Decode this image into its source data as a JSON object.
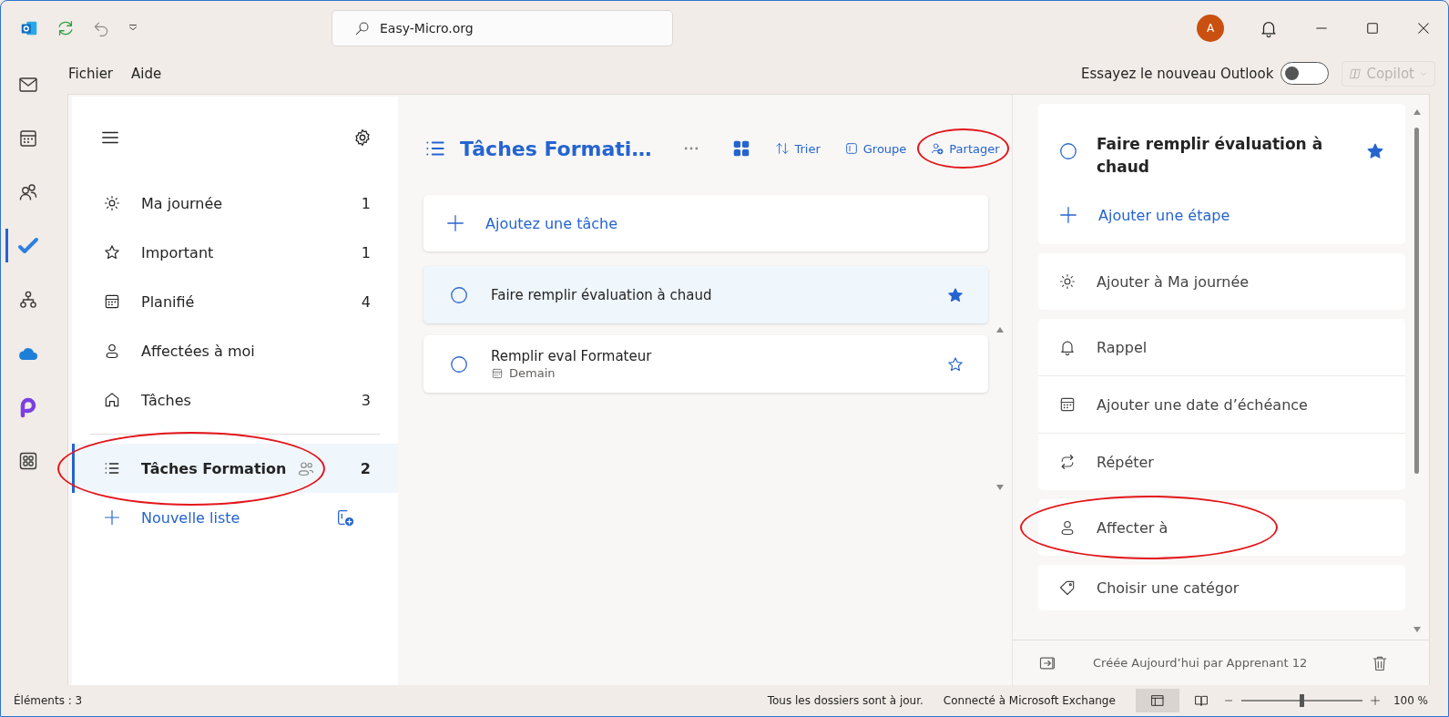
{
  "title_bar": {
    "search": {
      "value": "Easy-Micro.org"
    },
    "avatar": "A"
  },
  "menu": [
    {
      "label": "Fichier"
    },
    {
      "label": "Aide"
    }
  ],
  "new_outlook": {
    "label": "Essayez le nouveau Outlook",
    "on": false
  },
  "copilot": {
    "label": "Copilot",
    "disabled": true
  },
  "app_rail": [
    {
      "kind": "mail",
      "selected": false
    },
    {
      "kind": "calendar",
      "selected": false
    },
    {
      "kind": "people",
      "selected": false
    },
    {
      "kind": "todo",
      "selected": true
    },
    {
      "kind": "org",
      "selected": false
    },
    {
      "kind": "cloud",
      "selected": false
    },
    {
      "kind": "loop",
      "selected": false
    },
    {
      "kind": "apps",
      "selected": false
    }
  ],
  "sidebar": {
    "items": [
      {
        "kind": "sun",
        "label": "Ma journée",
        "count": "1",
        "selected": false
      },
      {
        "kind": "star",
        "label": "Important",
        "count": "1",
        "selected": false
      },
      {
        "kind": "calendar",
        "label": "Planifié",
        "count": "4",
        "selected": false
      },
      {
        "kind": "person",
        "label": "Affectées à moi",
        "selected": false
      },
      {
        "kind": "home",
        "label": "Tâches",
        "count": "3",
        "selected": false
      }
    ],
    "lists": [
      {
        "kind": "list",
        "label": "Tâches Formation",
        "count": "2",
        "shared": true,
        "selected": true,
        "highlighted": true
      }
    ],
    "new_list": "Nouvelle liste"
  },
  "task_list": {
    "title": "Tâches Formati…",
    "toolbar": [
      {
        "kind": "sort",
        "label": "Trier"
      },
      {
        "kind": "group",
        "label": "Groupe"
      },
      {
        "kind": "share",
        "label": "Partager",
        "highlighted": true
      }
    ],
    "add_task": {
      "placeholder": "Ajoutez une tâche"
    },
    "tasks": [
      {
        "title": "Faire remplir évaluation à chaud",
        "important": true,
        "selected": true
      },
      {
        "title": "Remplir eval Formateur",
        "due": "Demain",
        "important": false,
        "selected": false
      }
    ]
  },
  "detail": {
    "title": "Faire remplir évaluation à chaud",
    "important": true,
    "add_step": "Ajouter une étape",
    "sections": [
      {
        "rows": [
          {
            "kind": "sun",
            "label": "Ajouter à Ma journée",
            "highlighted": false
          }
        ]
      },
      {
        "rows": [
          {
            "kind": "bell",
            "label": "Rappel",
            "highlighted": false
          },
          {
            "kind": "calendar",
            "label": "Ajouter une date d’échéance",
            "highlighted": false
          },
          {
            "kind": "repeat",
            "label": "Répéter",
            "highlighted": false
          }
        ]
      },
      {
        "rows": [
          {
            "kind": "person",
            "label": "Affecter à",
            "highlighted": true
          }
        ]
      },
      {
        "rows": [
          {
            "kind": "tag",
            "label": "Choisir une catégor",
            "highlighted": false
          }
        ]
      }
    ],
    "footer": "Créée Aujourd’hui par Apprenant 12"
  },
  "status_bar": {
    "items": "Éléments : 3",
    "messages": [
      "Tous les dossiers sont à jour.",
      "Connecté à Microsoft Exchange"
    ],
    "views": [
      {
        "kind": "normal",
        "selected": true
      },
      {
        "kind": "reading",
        "selected": false
      }
    ],
    "zoom": {
      "level": 0.5,
      "reading": "100 %"
    }
  }
}
